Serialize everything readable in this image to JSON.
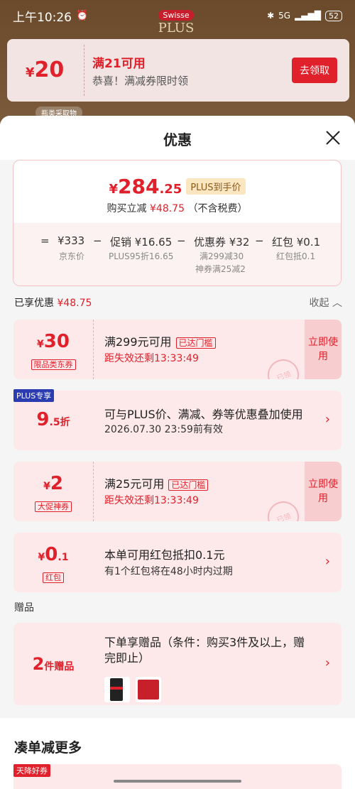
{
  "status": {
    "time": "上午10:26",
    "network": "5G",
    "battery": "52"
  },
  "brand": {
    "badge": "Swisse",
    "plus": "PLUS"
  },
  "top_coupon": {
    "currency": "¥",
    "amount": "20",
    "condition": "满21可用",
    "subtitle": "恭喜！满减券限时领",
    "button": "去领取"
  },
  "bg_tag": "瓶类采取物",
  "sheet": {
    "title": "优惠"
  },
  "summary": {
    "currency": "¥",
    "price_int": "284",
    "price_dec": ".25",
    "plus_tag": "PLUS到手价",
    "save_prefix": "购买立减",
    "save_amount": "¥48.75",
    "save_suffix": "（不含税费）",
    "breakdown": [
      {
        "sign": "=",
        "value": "¥333",
        "label": "京东价",
        "label2": ""
      },
      {
        "sign": "−",
        "value": "促销 ¥16.65",
        "label": "PLUS95折16.65",
        "label2": ""
      },
      {
        "sign": "−",
        "value": "优惠券 ¥32",
        "label": "满299减30",
        "label2": "神券满25减2"
      },
      {
        "sign": "−",
        "value": "红包 ¥0.1",
        "label": "红包抵0.1",
        "label2": ""
      }
    ]
  },
  "applied": {
    "label": "已享优惠",
    "amount": "¥48.75",
    "collapse": "收起"
  },
  "cards": [
    {
      "currency": "¥",
      "amount": "30",
      "tag": "限品类东券",
      "line1": "满299元可用",
      "reach": "已达门槛",
      "line2": "距失效还剩13:33:49",
      "action": "立即使用",
      "stamp": "已领"
    },
    {
      "badge": "PLUS专享",
      "amount": "9",
      "amount_suffix": ".5折",
      "line1": "可与PLUS价、满减、券等优惠叠加使用",
      "line2": "2026.07.30 23:59前有效",
      "chevron": "›"
    },
    {
      "currency": "¥",
      "amount": "2",
      "tag": "大促神券",
      "line1": "满25元可用",
      "reach": "已达门槛",
      "line2": "距失效还剩13:33:49",
      "action": "立即使用",
      "stamp": "已领"
    },
    {
      "currency": "¥",
      "amount": "0",
      "amount_suffix": ".1",
      "tag": "红包",
      "line1": "本单可用红包抵扣0.1元",
      "line2": "有1个红包将在48小时内过期",
      "chevron": "›"
    }
  ],
  "gifts": {
    "section": "赠品",
    "count": "2",
    "count_suffix": "件赠品",
    "line1": "下单享赠品（条件：购买3件及以上，赠",
    "line1b": "完即止）",
    "chevron": "›"
  },
  "more": {
    "title": "凑单减更多",
    "tag": "天降好券"
  },
  "colors": {
    "accent": "#e0202a",
    "pink_bg": "#fde9ea",
    "plus_blue": "#2b3bb0"
  }
}
